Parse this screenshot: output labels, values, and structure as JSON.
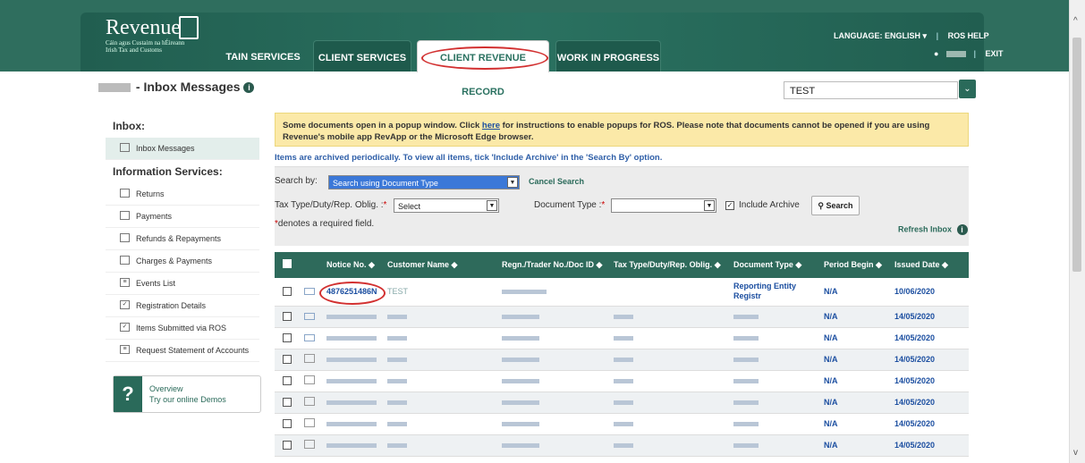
{
  "header": {
    "brand": "Revenue",
    "brand_sub1": "Cáin agus Custaim na hÉireann",
    "brand_sub2": "Irish Tax and Customs",
    "tabs": [
      {
        "label": "TAIN SERVICES"
      },
      {
        "label": "CLIENT SERVICES"
      },
      {
        "label": "CLIENT REVENUE RECORD"
      },
      {
        "label": "WORK IN PROGRESS"
      }
    ],
    "language": "LANGUAGE: ENGLISH",
    "ros_help": "ROS HELP",
    "exit": "EXIT"
  },
  "page": {
    "title": "- Inbox Messages",
    "client_select": "TEST"
  },
  "sidebar": {
    "inbox_heading": "Inbox:",
    "inbox_item": "Inbox Messages",
    "info_heading": "Information Services:",
    "items": [
      {
        "label": "Returns",
        "icon": "returns-icon"
      },
      {
        "label": "Payments",
        "icon": "payments-icon"
      },
      {
        "label": "Refunds & Repayments",
        "icon": "refunds-icon"
      },
      {
        "label": "Charges & Payments",
        "icon": "charges-icon"
      },
      {
        "label": "Events List",
        "icon": "list-icon"
      },
      {
        "label": "Registration Details",
        "icon": "check-icon"
      },
      {
        "label": "Items Submitted via ROS",
        "icon": "check-icon"
      },
      {
        "label": "Request Statement of Accounts",
        "icon": "document-icon"
      }
    ],
    "demo_title": "Overview",
    "demo_sub": "Try our online Demos"
  },
  "notice": {
    "text1": "Some documents open in a popup window. Click ",
    "link": "here",
    "text2": " for instructions to enable popups for ROS. Please note that documents cannot be opened if you are using Revenue's mobile app RevApp or the Microsoft Edge browser."
  },
  "archive_note": "Items are archived periodically. To view all items, tick 'Include Archive' in the 'Search By' option.",
  "search": {
    "search_by_label": "Search by:",
    "search_by_value": "Search using Document Type",
    "cancel_search": "Cancel Search",
    "tax_type_label": "Tax Type/Duty/Rep. Oblig. :",
    "tax_type_value": "Select",
    "doc_type_label": "Document Type :",
    "include_archive": "Include Archive",
    "search_button": "Search",
    "required_note": "denotes a required field.",
    "refresh_inbox": "Refresh Inbox"
  },
  "table": {
    "headers": [
      "Notice No.",
      "Customer Name",
      "Regn./Trader No./Doc ID",
      "Tax Type/Duty/Rep. Oblig.",
      "Document Type",
      "Period Begin",
      "Issued Date"
    ],
    "rows": [
      {
        "notice": "4876251486N",
        "customer": "TEST",
        "doc_type": "Reporting Entity Registr",
        "period": "N/A",
        "issued": "10/06/2020",
        "unread": true
      },
      {
        "notice": "",
        "customer": "",
        "doc_type": "",
        "period": "N/A",
        "issued": "14/05/2020",
        "unread": true
      },
      {
        "notice": "",
        "customer": "",
        "doc_type": "",
        "period": "N/A",
        "issued": "14/05/2020",
        "unread": true
      },
      {
        "notice": "",
        "customer": "",
        "doc_type": "",
        "period": "N/A",
        "issued": "14/05/2020",
        "unread": false
      },
      {
        "notice": "",
        "customer": "",
        "doc_type": "",
        "period": "N/A",
        "issued": "14/05/2020",
        "unread": false
      },
      {
        "notice": "",
        "customer": "",
        "doc_type": "",
        "period": "N/A",
        "issued": "14/05/2020",
        "unread": false
      },
      {
        "notice": "",
        "customer": "",
        "doc_type": "",
        "period": "N/A",
        "issued": "14/05/2020",
        "unread": false
      },
      {
        "notice": "",
        "customer": "",
        "doc_type": "",
        "period": "N/A",
        "issued": "14/05/2020",
        "unread": false
      }
    ]
  }
}
